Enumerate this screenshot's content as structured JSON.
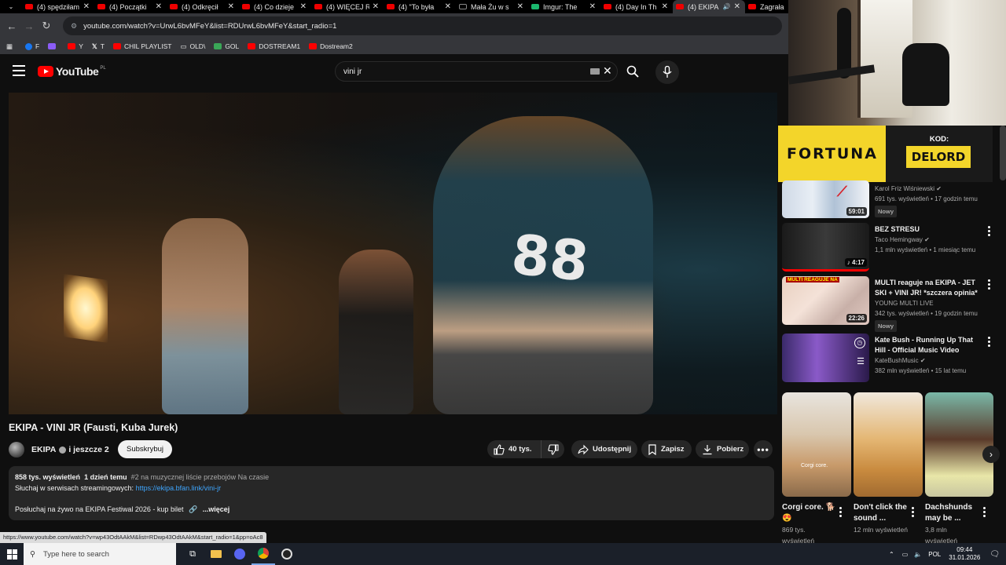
{
  "browser": {
    "tabs": [
      {
        "title": "(4) spędziłam",
        "favicon": "youtube"
      },
      {
        "title": "(4) Początki",
        "favicon": "youtube"
      },
      {
        "title": "(4) Odkręcił",
        "favicon": "youtube"
      },
      {
        "title": "(4) Co dzieje",
        "favicon": "youtube"
      },
      {
        "title": "(4) WIĘCEJ R",
        "favicon": "youtube"
      },
      {
        "title": "(4) \"To była",
        "favicon": "youtube"
      },
      {
        "title": "Mała Żu w s",
        "favicon": "x"
      },
      {
        "title": "Imgur: The",
        "favicon": "imgur"
      },
      {
        "title": "(4) Day In Th",
        "favicon": "youtube"
      },
      {
        "title": "(4) EKIPA",
        "favicon": "youtube"
      },
      {
        "title": "Zagrała",
        "favicon": "youtube"
      }
    ],
    "url": "youtube.com/watch?v=UrwL6bvMFeY&list=RDUrwL6bvMFeY&start_radio=1",
    "bookmarks": [
      {
        "label": "F",
        "color": "#1877f2"
      },
      {
        "label": "",
        "color": "#8b5cf6"
      },
      {
        "label": "Y",
        "color": "#ff0000"
      },
      {
        "label": "T",
        "color": "#ffffff"
      },
      {
        "label": "CHIL PLAYLIST",
        "color": "#ff0000"
      },
      {
        "label": "OLD\\",
        "color": "#cccccc"
      },
      {
        "label": "GOL",
        "color": "#3aa757"
      },
      {
        "label": "DOSTREAM1",
        "color": "#ff0000"
      },
      {
        "label": "Dostream2",
        "color": "#ff0000"
      }
    ],
    "status_url": "https://www.youtube.com/watch?v=wp43OdtAAkM&list=RDwp43OdtAAkM&start_radio=1&pp=oAc8"
  },
  "youtube": {
    "logo_text": "YouTube",
    "region": "PL",
    "search_query": "vini jr",
    "video": {
      "title": "EKIPA - VINI JR (Fausti, Kuba Jurek)",
      "jersey_number": "88",
      "channel": "EKIPA",
      "channel_suffix": "i jeszcze 2",
      "subscribe": "Subskrybuj",
      "likes": "40 tys.",
      "share": "Udostępnij",
      "save": "Zapisz",
      "download": "Pobierz"
    },
    "description": {
      "views": "858 tys. wyświetleń",
      "date": "1 dzień temu",
      "chart": "#2 na muzycznej liście przebojów Na czasie",
      "streaming_label": "Słuchaj w serwisach streamingowych:",
      "streaming_link": "https://ekipa.bfan.link/vini-jr",
      "festival": "Posłuchaj na żywo na EKIPA Festiwal 2026 - kup bilet",
      "more": "...więcej"
    },
    "recommendations": [
      {
        "title": "",
        "channel": "Karol Friz Wiśniewski",
        "meta": "691 tys. wyświetleń • 17 godzin temu",
        "badge": "Nowy",
        "duration": "59:01"
      },
      {
        "title": "BEZ STRESU",
        "channel": "Taco Hemingway",
        "meta": "1,1 mln wyświetleń • 1 miesiąc temu",
        "badge": "",
        "duration": "4:17"
      },
      {
        "title": "MULTI reaguje na EKIPA - JET SKI + VINI JR! *szczera opinia*",
        "channel": "YOUNG MULTI LIVE",
        "meta": "342 tys. wyświetleń • 19 godzin temu",
        "badge": "Nowy",
        "duration": "22:26"
      },
      {
        "title": "Kate Bush - Running Up That Hill - Official Music Video",
        "channel": "KateBushMusic",
        "meta": "382 mln wyświetleń • 15 lat temu",
        "badge": "",
        "duration": ""
      }
    ],
    "shorts": [
      {
        "title": "Corgi core. 🐕😍",
        "views": "869 tys. wyświetleń",
        "overlay": "Corgi core."
      },
      {
        "title": "Don't click the sound ...",
        "views": "12 mln wyświetleń",
        "overlay": ""
      },
      {
        "title": "Dachshunds may be ...",
        "views": "3,8 mln wyświetleń",
        "overlay": ""
      }
    ]
  },
  "overlay": {
    "brand": "FORTUNA",
    "code_label": "KOD:",
    "code": "DELORD"
  },
  "taskbar": {
    "search_placeholder": "Type here to search",
    "language": "POL",
    "time": "09:44",
    "date": "31.01.2026"
  }
}
